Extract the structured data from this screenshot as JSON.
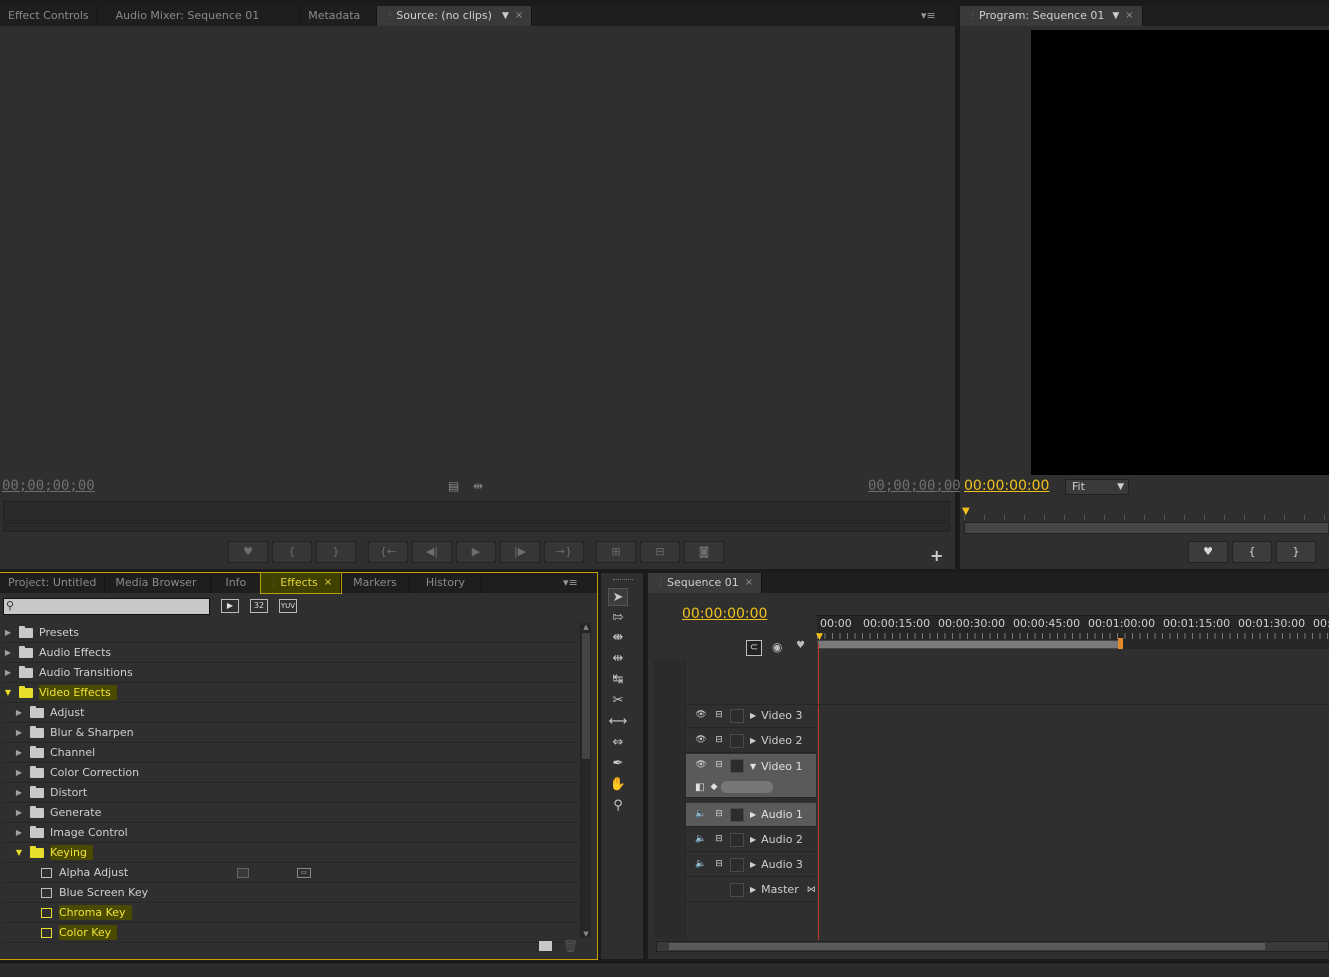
{
  "source_panel": {
    "tabs": [
      {
        "label": "Effect Controls"
      },
      {
        "label": "Audio Mixer: Sequence 01"
      },
      {
        "label": "Metadata"
      },
      {
        "label": "Source: (no clips)"
      }
    ],
    "timecode_left": "00;00;00;00",
    "timecode_right": "00;00;00;00"
  },
  "program_panel": {
    "tab_label": "Program: Sequence 01",
    "timecode": "00:00:00:00",
    "zoom_value": "Fit"
  },
  "project_panel": {
    "tabs": [
      {
        "label": "Project: Untitled"
      },
      {
        "label": "Media Browser"
      },
      {
        "label": "Info"
      },
      {
        "label": "Effects"
      },
      {
        "label": "Markers"
      },
      {
        "label": "History"
      }
    ],
    "search_placeholder": "",
    "badge_32": "32",
    "badge_yuv": "YUV",
    "tree": [
      {
        "label": "Presets",
        "level": 0,
        "type": "folder",
        "expanded": false,
        "highlight": false
      },
      {
        "label": "Audio Effects",
        "level": 0,
        "type": "folder",
        "expanded": false,
        "highlight": false
      },
      {
        "label": "Audio Transitions",
        "level": 0,
        "type": "folder",
        "expanded": false,
        "highlight": false
      },
      {
        "label": "Video Effects",
        "level": 0,
        "type": "folder",
        "expanded": true,
        "highlight": true
      },
      {
        "label": "Adjust",
        "level": 1,
        "type": "folder",
        "expanded": false,
        "highlight": false
      },
      {
        "label": "Blur & Sharpen",
        "level": 1,
        "type": "folder",
        "expanded": false,
        "highlight": false
      },
      {
        "label": "Channel",
        "level": 1,
        "type": "folder",
        "expanded": false,
        "highlight": false
      },
      {
        "label": "Color Correction",
        "level": 1,
        "type": "folder",
        "expanded": false,
        "highlight": false
      },
      {
        "label": "Distort",
        "level": 1,
        "type": "folder",
        "expanded": false,
        "highlight": false
      },
      {
        "label": "Generate",
        "level": 1,
        "type": "folder",
        "expanded": false,
        "highlight": false
      },
      {
        "label": "Image Control",
        "level": 1,
        "type": "folder",
        "expanded": false,
        "highlight": false
      },
      {
        "label": "Keying",
        "level": 1,
        "type": "folder",
        "expanded": true,
        "highlight": true
      },
      {
        "label": "Alpha Adjust",
        "level": 2,
        "type": "effect",
        "highlight": false
      },
      {
        "label": "Blue Screen Key",
        "level": 2,
        "type": "effect",
        "highlight": false
      },
      {
        "label": "Chroma Key",
        "level": 2,
        "type": "effect",
        "highlight": true
      },
      {
        "label": "Color Key",
        "level": 2,
        "type": "effect",
        "highlight": true
      }
    ]
  },
  "timeline_panel": {
    "tab_label": "Sequence 01",
    "timecode": "00:00:00:00",
    "ruler_labels": [
      "00:00",
      "00:00:15:00",
      "00:00:30:00",
      "00:00:45:00",
      "00:01:00:00",
      "00:01:15:00",
      "00:01:30:00",
      "00:0"
    ],
    "tracks": [
      {
        "name": "Video 3",
        "kind": "video",
        "expanded": false
      },
      {
        "name": "Video 2",
        "kind": "video",
        "expanded": false
      },
      {
        "name": "Video 1",
        "kind": "video",
        "expanded": true
      },
      {
        "name": "Audio 1",
        "kind": "audio",
        "expanded": false
      },
      {
        "name": "Audio 2",
        "kind": "audio",
        "expanded": false
      },
      {
        "name": "Audio 3",
        "kind": "audio",
        "expanded": false
      },
      {
        "name": "Master",
        "kind": "master",
        "expanded": false
      }
    ]
  },
  "colors": {
    "accent_yellow": "#f1c21b",
    "highlight_yellow": "#e8dd2a",
    "playhead_red": "#c0392b",
    "panel_bg": "#2f2f2f"
  }
}
